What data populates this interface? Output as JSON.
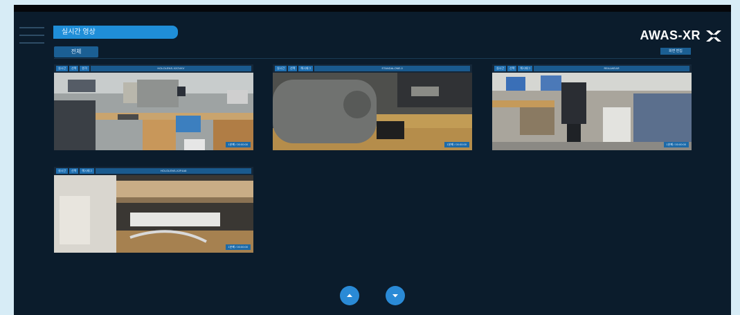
{
  "header": {
    "page_title": "실시간 영상",
    "filter_all_label": "전체",
    "brand_name": "AWAS-XR",
    "edit_label": "화면 편집"
  },
  "cameras": [
    {
      "chips": [
        "실시간",
        "선택",
        "원격"
      ],
      "name": "HOLOLENS-X2OVKV",
      "stamp": "1분째 / 00:00:00"
    },
    {
      "chips": [
        "실시간",
        "선택",
        "해시태그"
      ],
      "name": "STANDALONE-0",
      "stamp": "1분째 / 00:00:00"
    },
    {
      "chips": [
        "실시간",
        "선택",
        "해시태그"
      ],
      "name": "REALWEAR",
      "stamp": "1분째 / 00:00:00"
    },
    {
      "chips": [
        "실시간",
        "선택",
        "해시태그"
      ],
      "name": "HOLOLENS-X2F4A8",
      "stamp": "1분째 / 00:00:00"
    }
  ],
  "colors": {
    "accent": "#1f8ed8",
    "background": "#0b1c2c"
  },
  "icons": {
    "prev": "chevron-up-icon",
    "next": "chevron-down-icon"
  }
}
